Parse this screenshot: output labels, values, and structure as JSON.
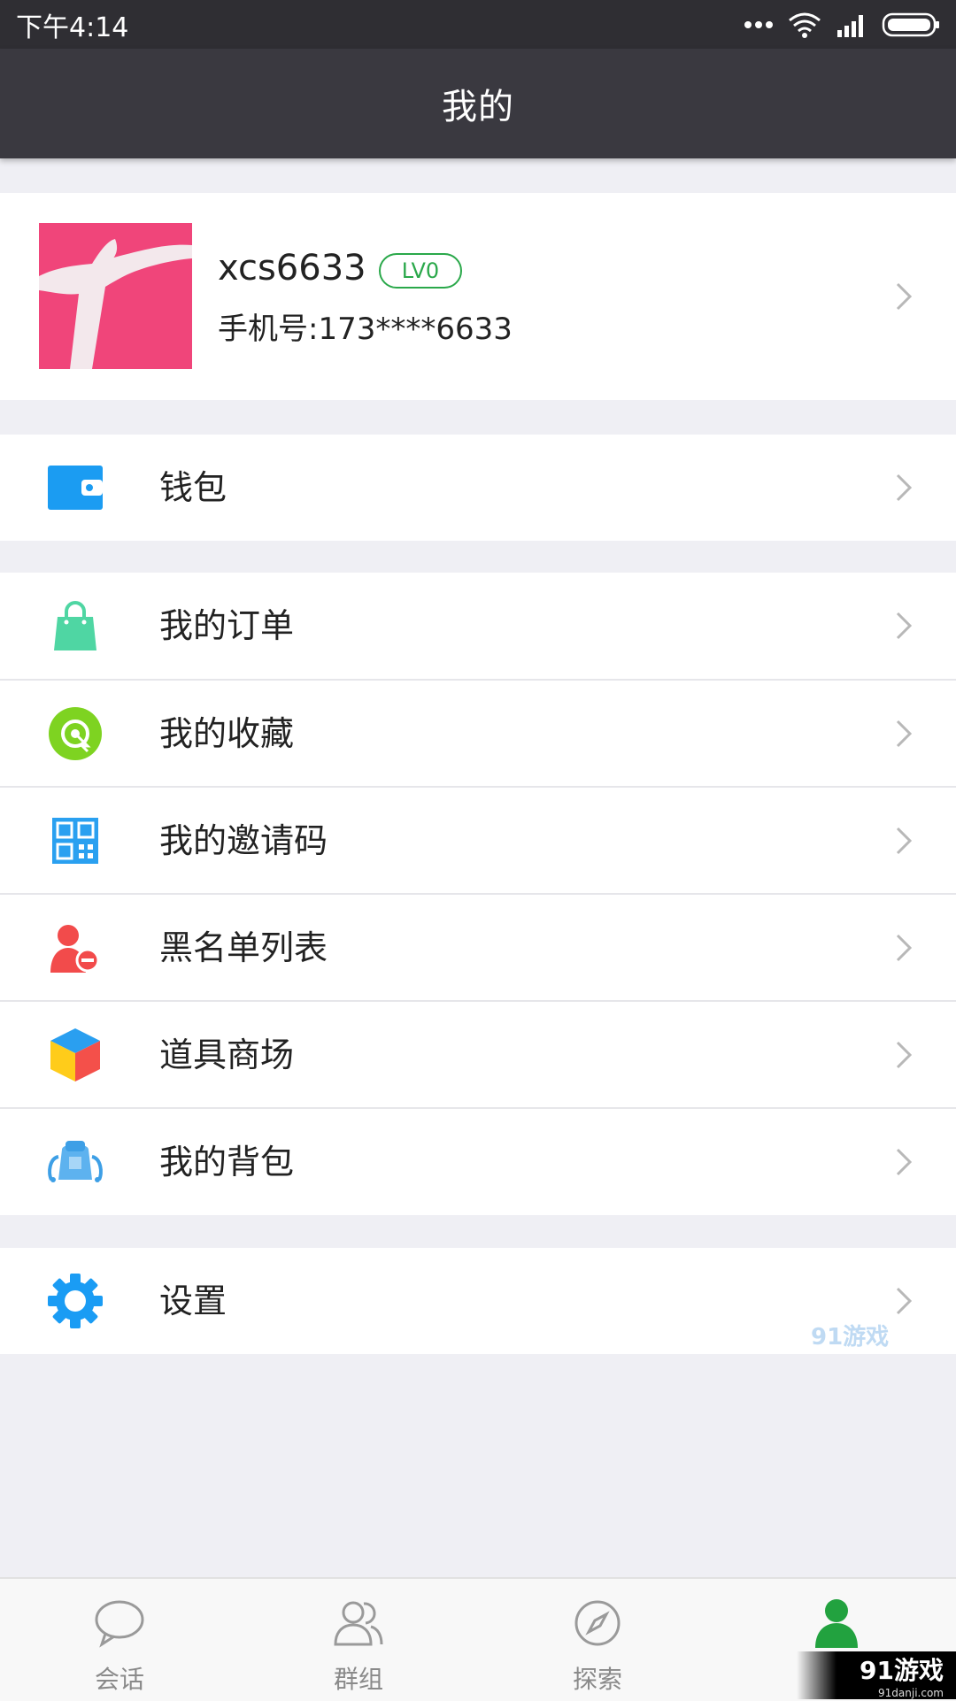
{
  "status_bar": {
    "time": "下午4:14"
  },
  "app_bar": {
    "title": "我的"
  },
  "profile": {
    "username": "xcs6633",
    "level": "LV0",
    "phone": "手机号:173****6633"
  },
  "menu": {
    "wallet": "钱包",
    "orders": "我的订单",
    "favorites": "我的收藏",
    "invite_code": "我的邀请码",
    "blacklist": "黑名单列表",
    "prop_store": "道具商场",
    "backpack": "我的背包",
    "settings": "设置"
  },
  "bottom_nav": {
    "tabs": [
      "会话",
      "群组",
      "探索",
      ""
    ]
  },
  "watermark": {
    "text": "91游戏",
    "url": "91danji.com"
  },
  "colors": {
    "accent_green": "#22a23f",
    "badge_green": "#2aa84a",
    "header_bg": "#3a3940",
    "status_bg": "#2f2e33",
    "wallet_blue": "#1b9cf2",
    "bag_teal": "#4fd6a3",
    "fav_green": "#7ed321",
    "qr_blue": "#2aa0f0",
    "blacklist_red": "#f24b4b",
    "settings_blue": "#1a9cf4"
  },
  "icons": [
    "wifi-icon",
    "signal-icon",
    "battery-icon",
    "more-dots-icon",
    "wallet-icon",
    "shopping-bag-icon",
    "favorites-icon",
    "qr-code-icon",
    "user-block-icon",
    "cube-icon",
    "backpack-icon",
    "gear-icon",
    "chat-bubble-icon",
    "group-icon",
    "compass-icon",
    "person-icon",
    "chevron-right-icon"
  ]
}
